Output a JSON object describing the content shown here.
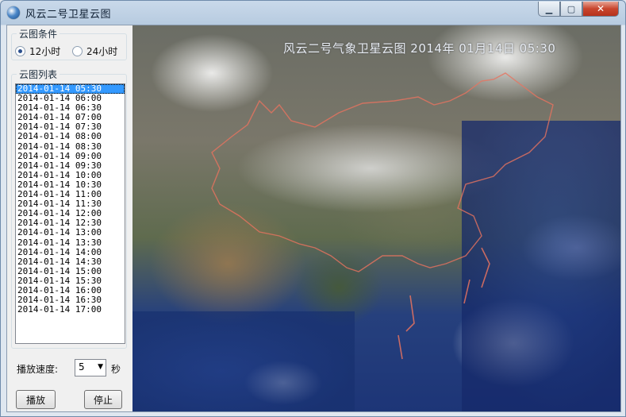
{
  "window": {
    "title": "风云二号卫星云图",
    "controls": {
      "minimize": "▁",
      "maximize": "▢",
      "close": "✕"
    }
  },
  "conditions": {
    "label": "云图条件",
    "options": [
      {
        "label": "12小时",
        "checked": true
      },
      {
        "label": "24小时",
        "checked": false
      }
    ]
  },
  "list": {
    "label": "云图列表",
    "selected_index": 0,
    "items": [
      "2014-01-14 05:30",
      "2014-01-14 06:00",
      "2014-01-14 06:30",
      "2014-01-14 07:00",
      "2014-01-14 07:30",
      "2014-01-14 08:00",
      "2014-01-14 08:30",
      "2014-01-14 09:00",
      "2014-01-14 09:30",
      "2014-01-14 10:00",
      "2014-01-14 10:30",
      "2014-01-14 11:00",
      "2014-01-14 11:30",
      "2014-01-14 12:00",
      "2014-01-14 12:30",
      "2014-01-14 13:00",
      "2014-01-14 13:30",
      "2014-01-14 14:00",
      "2014-01-14 14:30",
      "2014-01-14 15:00",
      "2014-01-14 15:30",
      "2014-01-14 16:00",
      "2014-01-14 16:30",
      "2014-01-14 17:00"
    ]
  },
  "speed": {
    "label": "播放速度:",
    "value": "5",
    "unit": "秒"
  },
  "buttons": {
    "play": "播放",
    "stop": "停止"
  },
  "map": {
    "overlay_title": "风云二号气象卫星云图 2014年 01月14日 05:30",
    "border_color": "#e8735f"
  }
}
